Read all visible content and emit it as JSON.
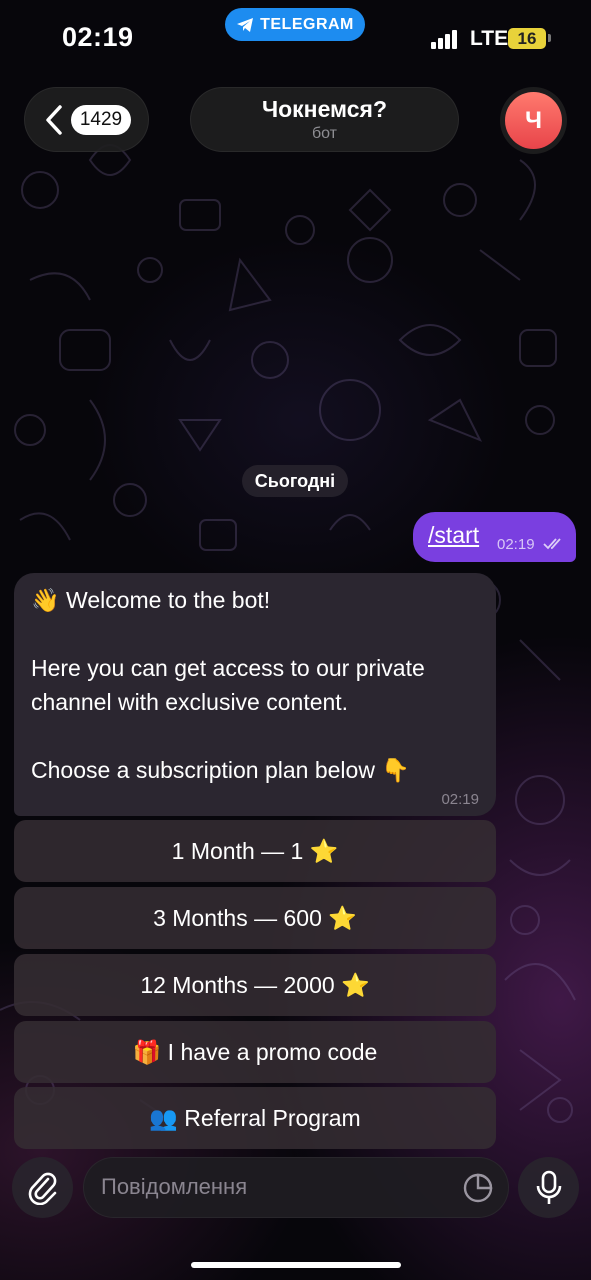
{
  "status_bar": {
    "time": "02:19",
    "app_pill": "TELEGRAM",
    "network": "LTE",
    "battery": "16"
  },
  "header": {
    "unread_count": "1429",
    "title": "Чокнемся?",
    "subtitle": "бот",
    "avatar_letter": "Ч"
  },
  "chat": {
    "date_chip": "Сьогодні",
    "outgoing": {
      "text": "/start",
      "time": "02:19"
    },
    "incoming": {
      "line1": "👋 Welcome to the bot!",
      "line2": "Here you can get access to our private",
      "line3": "channel with exclusive content.",
      "line4": "Choose a subscription plan below 👇",
      "time": "02:19"
    },
    "keyboard": [
      {
        "label": "1 Month — 1 ⭐"
      },
      {
        "label": "3 Months — 600 ⭐"
      },
      {
        "label": "12 Months — 2000 ⭐"
      },
      {
        "label": "🎁 I have a promo code"
      },
      {
        "label": "👥 Referral Program"
      }
    ]
  },
  "input_bar": {
    "placeholder": "Повідомлення"
  },
  "colors": {
    "accent_outgoing": "#7a3fe0",
    "incoming_bubble": "#2b2630",
    "telegram_blue": "#1d8cf0",
    "avatar": "#ef5a5a"
  },
  "icons": [
    "paperclip-icon",
    "sticker-icon",
    "microphone-icon",
    "back-chevron-icon",
    "telegram-plane-icon",
    "double-check-icon"
  ]
}
